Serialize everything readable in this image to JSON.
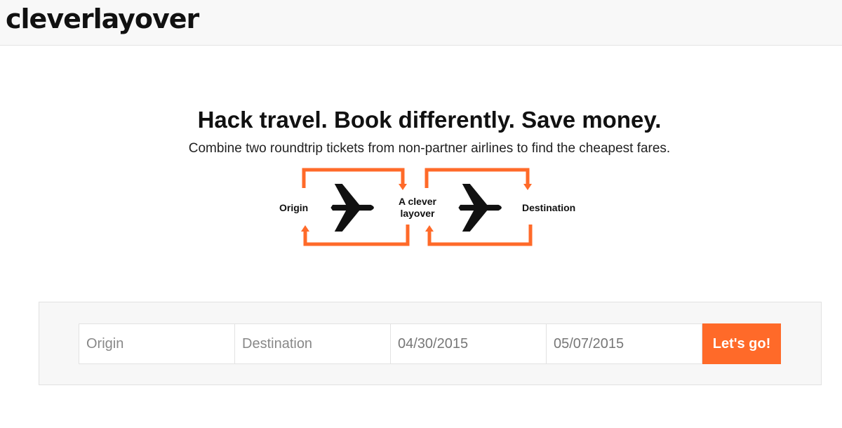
{
  "brand": {
    "name": "cleverlayover",
    "accent": "#ff6a29"
  },
  "hero": {
    "headline": "Hack travel. Book differently. Save money.",
    "subheadline": "Combine two roundtrip tickets from non-partner airlines to find the cheapest fares."
  },
  "diagram": {
    "origin": "Origin",
    "layover": "A clever layover",
    "destination": "Destination",
    "icons": [
      "airplane-icon",
      "airplane-icon",
      "arrow-icon"
    ]
  },
  "search": {
    "origin_placeholder": "Origin",
    "destination_placeholder": "Destination",
    "depart_date": "04/30/2015",
    "return_date": "05/07/2015",
    "submit_label": "Let's go!"
  }
}
